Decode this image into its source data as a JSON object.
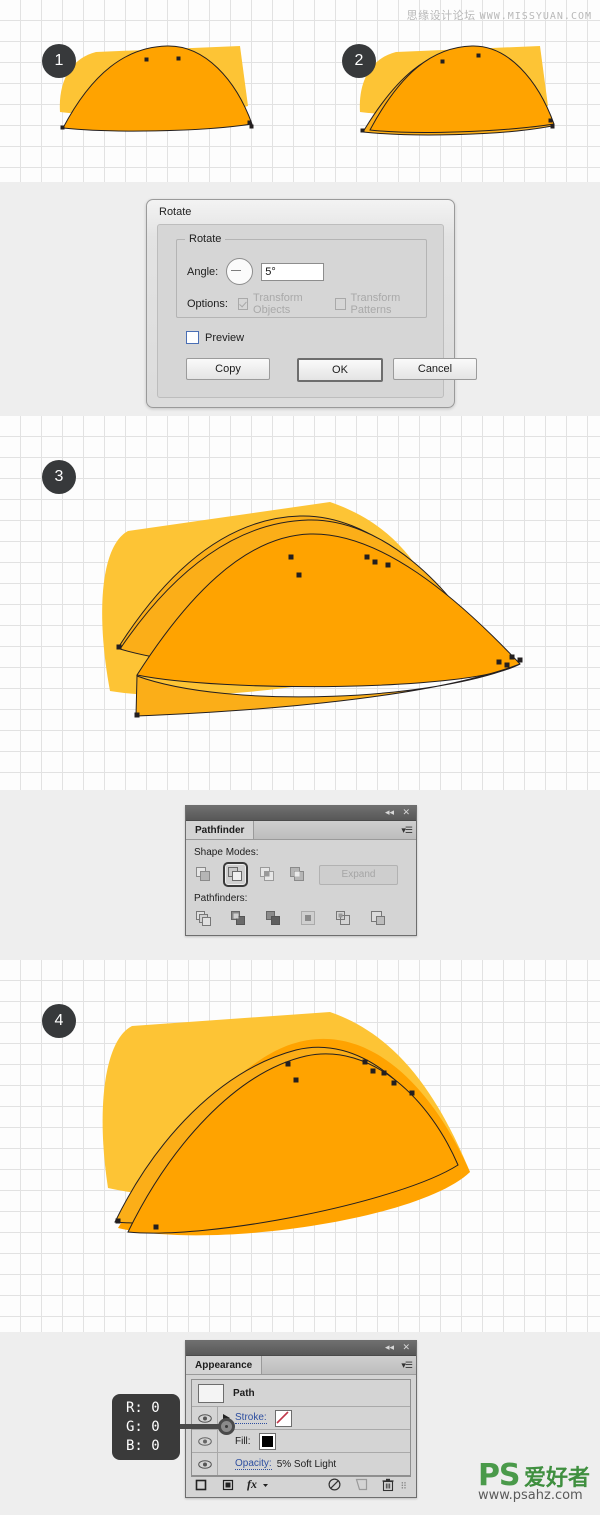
{
  "watermarks": {
    "top_cn": "思缘设计论坛",
    "top_en": "WWW.MISSYUAN.COM",
    "bottom_ps": "PS",
    "bottom_cn": "爱好者",
    "bottom_url": "www.psahz.com"
  },
  "steps": [
    {
      "number": "1"
    },
    {
      "number": "2"
    },
    {
      "number": "3"
    },
    {
      "number": "4"
    }
  ],
  "rotate_dialog": {
    "title": "Rotate",
    "fieldset_legend": "Rotate",
    "angle_label": "Angle:",
    "angle_value": "5°",
    "options_label": "Options:",
    "transform_objects": "Transform Objects",
    "transform_patterns": "Transform Patterns",
    "preview_label": "Preview",
    "buttons": {
      "copy": "Copy",
      "ok": "OK",
      "cancel": "Cancel"
    }
  },
  "pathfinder_panel": {
    "tab": "Pathfinder",
    "shape_modes_label": "Shape Modes:",
    "pathfinders_label": "Pathfinders:",
    "expand_label": "Expand",
    "collapse_icon": "collapse-icon",
    "close_icon": "close-icon",
    "shape_modes": [
      {
        "name": "unite",
        "active": false
      },
      {
        "name": "minus-front",
        "active": true
      },
      {
        "name": "intersect",
        "active": false
      },
      {
        "name": "exclude",
        "active": false
      }
    ],
    "pathfinders": [
      {
        "name": "divide"
      },
      {
        "name": "trim"
      },
      {
        "name": "merge"
      },
      {
        "name": "crop"
      },
      {
        "name": "outline"
      },
      {
        "name": "minus-back"
      }
    ]
  },
  "appearance_panel": {
    "tab": "Appearance",
    "rows": [
      {
        "name": "path",
        "label": "Path"
      },
      {
        "name": "stroke",
        "label": "Stroke:"
      },
      {
        "name": "fill",
        "label": "Fill:"
      },
      {
        "name": "opacity",
        "label": "Opacity:",
        "value": "5% Soft Light"
      }
    ],
    "footer_icons": [
      "add-new-stroke-icon",
      "add-new-fill-icon",
      "add-effect-icon",
      "clear-appearance-icon",
      "duplicate-item-icon",
      "delete-item-icon"
    ]
  },
  "color_callout": {
    "r": "R: 0",
    "g": "G: 0",
    "b": "B: 0"
  },
  "colors": {
    "light_orange": "#FDC435",
    "main_orange": "#FFA300",
    "mid_orange": "#FBAE18",
    "grid_line": "#e2e2e2",
    "canvas_bg": "#fdfdfd",
    "page_bg": "#eeeeee",
    "badge_bg": "#37393b",
    "stroke": "#231f20"
  }
}
